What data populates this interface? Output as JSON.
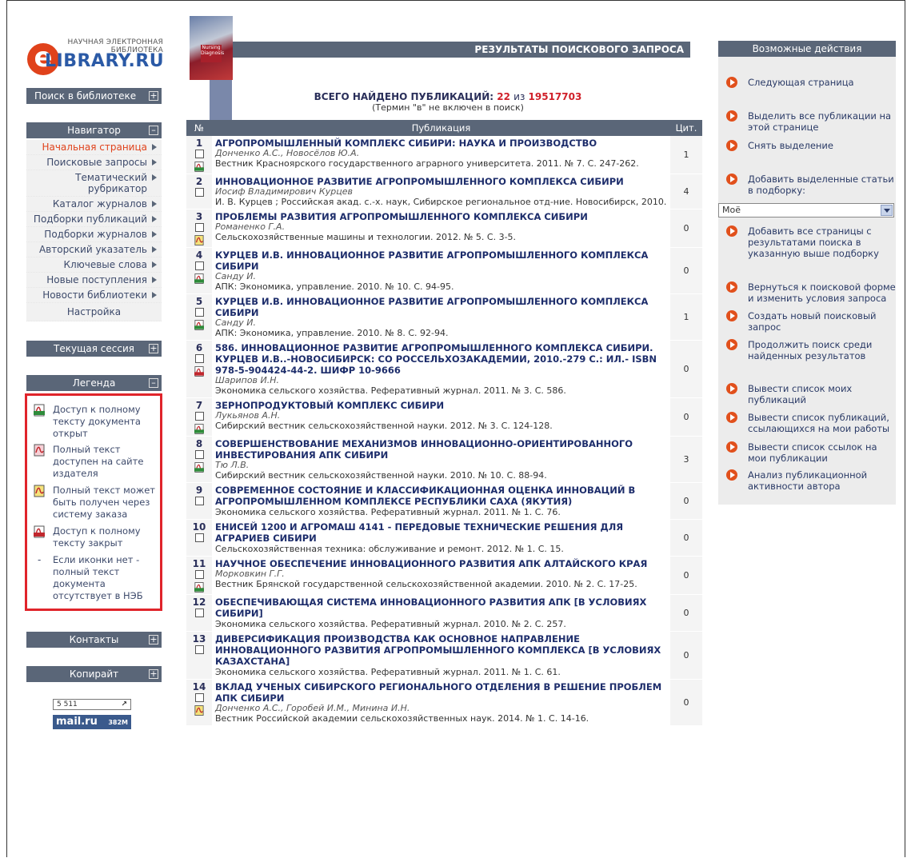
{
  "logo": {
    "line1": "НАУЧНАЯ ЭЛЕКТРОННАЯ",
    "line2": "БИБЛИОТЕКА",
    "name": "LIBRARY.RU",
    "e": "e"
  },
  "sidebar": {
    "search_head": "Поиск в библиотеке",
    "nav_head": "Навигатор",
    "nav_items": [
      "Начальная страница",
      "Поисковые запросы",
      "Тематический рубрикатор",
      "Каталог журналов",
      "Подборки публикаций",
      "Подборки журналов",
      "Авторский указатель",
      "Ключевые слова",
      "Новые поступления",
      "Новости библиотеки",
      "Настройка"
    ],
    "session_head": "Текущая сессия",
    "legend_head": "Легенда",
    "legend": [
      {
        "text": "Доступ к полному тексту документа открыт",
        "icon": "pdf-green-icon"
      },
      {
        "text": "Полный текст доступен на сайте издателя",
        "icon": "pdf-pink-icon"
      },
      {
        "text": "Полный текст может быть получен через систему заказа",
        "icon": "pdf-yellow-icon"
      },
      {
        "text": "Доступ к полному тексту закрыт",
        "icon": "pdf-red-icon"
      },
      {
        "text": "Если иконки нет - полный текст документа отсутствует в НЭБ",
        "icon": "dash"
      }
    ],
    "contacts_head": "Контакты",
    "copyright_head": "Копирайт",
    "counter": "5 511",
    "counter_arrow": "↗",
    "mailru": "mail.ru",
    "mailru_num": "382M",
    "toggle_plus": "+",
    "toggle_minus": "–"
  },
  "header": {
    "bar": "РЕЗУЛЬТАТЫ ПОИСКОВОГО ЗАПРОСА",
    "total_label": "ВСЕГО НАЙДЕНО ПУБЛИКАЦИЙ:",
    "total_found": "22",
    "total_sep": "из",
    "total_all": "19517703",
    "note": "(Термин \"в\" не включен в поиск)",
    "cover_text": "Nursing Diagnosis"
  },
  "table": {
    "col_no": "№",
    "col_pub": "Публикация",
    "col_cit": "Цит.",
    "rows": [
      {
        "n": "1",
        "title": "АГРОПРОМЫШЛЕННЫЙ КОМПЛЕКС СИБИРИ: НАУКА И ПРОИЗВОДСТВО",
        "authors": "Донченко А.С., Новосёлов Ю.А.",
        "source": "Вестник Красноярского государственного аграрного университета. 2011. № 7. С. 247-262.",
        "cit": "1",
        "icon": "green"
      },
      {
        "n": "2",
        "title": "ИННОВАЦИОННОЕ РАЗВИТИЕ АГРОПРОМЫШЛЕННОГО КОМПЛЕКСА СИБИРИ",
        "authors": "Иосиф Владимирович Курцев",
        "source": "И. В. Курцев ; Российская акад. с.-х. наук, Сибирское региональное отд-ние. Новосибирск, 2010.",
        "cit": "4",
        "icon": ""
      },
      {
        "n": "3",
        "title": "ПРОБЛЕМЫ РАЗВИТИЯ АГРОПРОМЫШЛЕННОГО КОМПЛЕКСА СИБИРИ",
        "authors": "Романенко Г.А.",
        "source": "Сельскохозяйственные машины и технологии. 2012. № 5. С. 3-5.",
        "cit": "0",
        "icon": "yellow"
      },
      {
        "n": "4",
        "title": "КУРЦЕВ И.В. ИННОВАЦИОННОЕ РАЗВИТИЕ АГРОПРОМЫШЛЕННОГО КОМПЛЕКСА СИБИРИ",
        "authors": "Санду И.",
        "source": "АПК: Экономика, управление. 2010. № 10. С. 94-95.",
        "cit": "0",
        "icon": "green"
      },
      {
        "n": "5",
        "title": "КУРЦЕВ И.В. ИННОВАЦИОННОЕ РАЗВИТИЕ АГРОПРОМЫШЛЕННОГО КОМПЛЕКСА СИБИРИ",
        "authors": "Санду И.",
        "source": "АПК: Экономика, управление. 2010. № 8. С. 92-94.",
        "cit": "1",
        "icon": "green"
      },
      {
        "n": "6",
        "title": "586. ИННОВАЦИОННОЕ РАЗВИТИЕ АГРОПРОМЫШЛЕННОГО КОМПЛЕКСА СИБИРИ. КУРЦЕВ И.В..-НОВОСИБИРСК: СО РОССЕЛЬХОЗАКАДЕМИИ, 2010.-279 С.: ИЛ.- ISBN 978-5-904424-44-2. ШИФР 10-9666",
        "authors": "Шарипов И.Н.",
        "source": "Экономика сельского хозяйства. Реферативный журнал. 2011. № 3. С. 586.",
        "cit": "0",
        "icon": "red"
      },
      {
        "n": "7",
        "title": "ЗЕРНОПРОДУКТОВЫЙ КОМПЛЕКС СИБИРИ",
        "authors": "Лукьянов А.Н.",
        "source": "Сибирский вестник сельскохозяйственной науки. 2012. № 3. С. 124-128.",
        "cit": "0",
        "icon": "green"
      },
      {
        "n": "8",
        "title": "СОВЕРШЕНСТВОВАНИЕ МЕХАНИЗМОВ ИННОВАЦИОННО-ОРИЕНТИРОВАННОГО ИНВЕСТИРОВАНИЯ АПК СИБИРИ",
        "authors": "Тю Л.В.",
        "source": "Сибирский вестник сельскохозяйственной науки. 2010. № 10. С. 88-94.",
        "cit": "3",
        "icon": "green"
      },
      {
        "n": "9",
        "title": "СОВРЕМЕННОЕ СОСТОЯНИЕ И КЛАССИФИКАЦИОННАЯ ОЦЕНКА ИННОВАЦИЙ В АГРОПРОМЫШЛЕННОМ КОМПЛЕКСЕ РЕСПУБЛИКИ САХА (ЯКУТИЯ)",
        "authors": "",
        "source": "Экономика сельского хозяйства. Реферативный журнал. 2011. № 1. С. 76.",
        "cit": "0",
        "icon": ""
      },
      {
        "n": "10",
        "title": "ЕНИСЕЙ 1200 И АГРОМАШ 4141 - ПЕРЕДОВЫЕ ТЕХНИЧЕСКИЕ РЕШЕНИЯ ДЛЯ АГРАРИЕВ СИБИРИ",
        "authors": "",
        "source": "Сельскохозяйственная техника: обслуживание и ремонт. 2012. № 1. С. 15.",
        "cit": "0",
        "icon": ""
      },
      {
        "n": "11",
        "title": "НАУЧНОЕ ОБЕСПЕЧЕНИЕ ИННОВАЦИОННОГО РАЗВИТИЯ АПК АЛТАЙСКОГО КРАЯ",
        "authors": "Морковкин Г.Г.",
        "source": "Вестник Брянской государственной сельскохозяйственной академии. 2010. № 2. С. 17-25.",
        "cit": "0",
        "icon": "green"
      },
      {
        "n": "12",
        "title": "ОБЕСПЕЧИВАЮЩАЯ СИСТЕМА ИННОВАЦИОННОГО РАЗВИТИЯ АПК [В УСЛОВИЯХ СИБИРИ]",
        "authors": "",
        "source": "Экономика сельского хозяйства. Реферативный журнал. 2010. № 2. С. 257.",
        "cit": "0",
        "icon": ""
      },
      {
        "n": "13",
        "title": "ДИВЕРСИФИКАЦИЯ ПРОИЗВОДСТВА КАК ОСНОВНОЕ НАПРАВЛЕНИЕ ИННОВАЦИОННОГО РАЗВИТИЯ АГРОПРОМЫШЛЕННОГО КОМПЛЕКСА [В УСЛОВИЯХ КАЗАХСТАНА]",
        "authors": "",
        "source": "Экономика сельского хозяйства. Реферативный журнал. 2011. № 1. С. 61.",
        "cit": "0",
        "icon": ""
      },
      {
        "n": "14",
        "title": "ВКЛАД УЧЕНЫХ СИБИРСКОГО РЕГИОНАЛЬНОГО ОТДЕЛЕНИЯ В РЕШЕНИЕ ПРОБЛЕМ АПК СИБИРИ",
        "authors": "Донченко А.С., Горобей И.М., Минина И.Н.",
        "source": "Вестник Российской академии сельскохозяйственных наук. 2014. № 1. С. 14-16.",
        "cit": "0",
        "icon": "yellow"
      }
    ]
  },
  "actions": {
    "head": "Возможные действия",
    "items": [
      "Следующая страница",
      "Выделить все публикации на этой странице",
      "Снять выделение",
      "Добавить выделенные статьи в подборку:",
      "Добавить все страницы с результатами поиска в указанную выше подборку",
      "Вернуться к поисковой форме и изменить условия запроса",
      "Создать новый поисковый запрос",
      "Продолжить поиск среди найденных результатов",
      "Вывести список моих публикаций",
      "Вывести список публикаций, ссылающихся на мои работы",
      "Вывести список ссылок на мои публикации",
      "Анализ публикационной активности автора"
    ],
    "select_value": "Моё"
  },
  "colors": {
    "accent": "#e1501c",
    "header": "#5a6678",
    "title": "#1d2d6b",
    "red": "#d0202a",
    "legend_border": "#e0242b"
  }
}
